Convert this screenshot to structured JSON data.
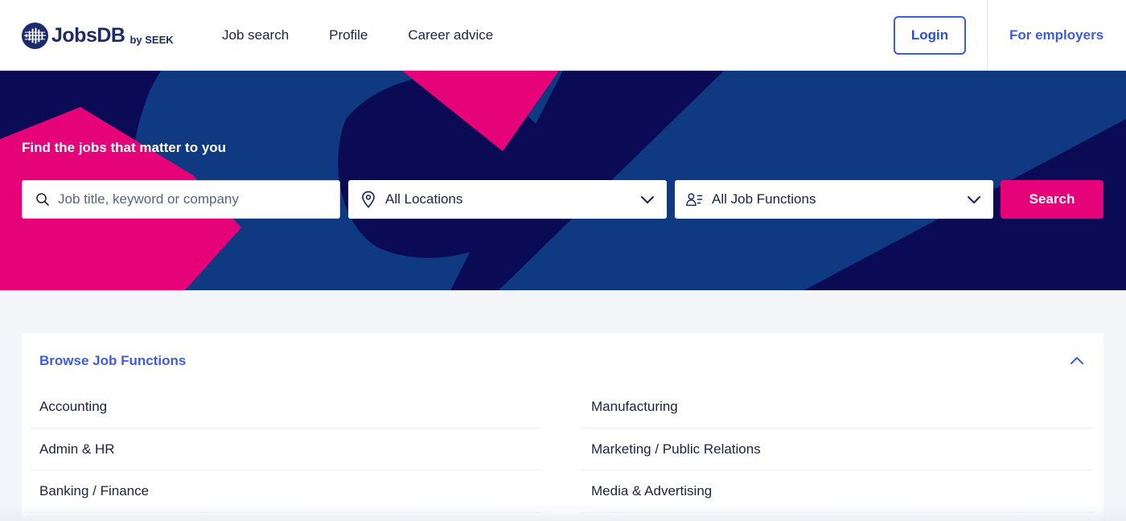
{
  "header": {
    "logo_text": "JobsDB",
    "logo_by": "by SEEK",
    "nav": [
      "Job search",
      "Profile",
      "Career advice"
    ],
    "login": "Login",
    "employers": "For employers"
  },
  "hero": {
    "title": "Find the jobs that matter to you",
    "keyword_placeholder": "Job title, keyword or company",
    "location_value": "All Locations",
    "function_value": "All Job Functions",
    "search_label": "Search"
  },
  "browse": {
    "title": "Browse Job Functions",
    "left_items": [
      "Accounting",
      "Admin & HR",
      "Banking / Finance"
    ],
    "right_items": [
      "Manufacturing",
      "Marketing / Public Relations",
      "Media & Advertising"
    ]
  },
  "colors": {
    "brand_navy": "#1c2b6b",
    "accent_blue": "#3e5ce0",
    "accent_pink": "#e60278",
    "hero_navy": "#0a0a55",
    "hero_blue": "#0f3a82"
  }
}
